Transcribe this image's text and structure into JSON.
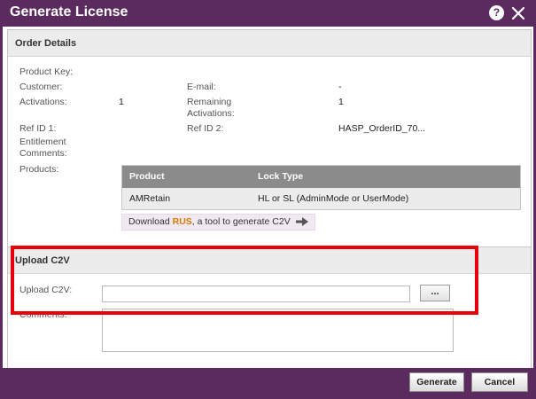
{
  "dialog": {
    "title": "Generate License",
    "help_symbol": "?"
  },
  "order_details": {
    "header": "Order Details",
    "product_key_label": "Product Key:",
    "customer_label": "Customer:",
    "email_label": "E-mail:",
    "email_value": "-",
    "activations_label": "Activations:",
    "activations_value": "1",
    "remaining_label_line1": "Remaining",
    "remaining_label_line2": "Activations:",
    "remaining_value": "1",
    "ref_id1_label": "Ref ID 1:",
    "ref_id2_label": "Ref ID 2:",
    "ref_id2_value": "HASP_OrderID_70...",
    "entitlement_label_line1": "Entitlement",
    "entitlement_label_line2": "Comments:",
    "products_label": "Products:",
    "products_table": {
      "headers": [
        "Product",
        "Lock Type"
      ],
      "rows": [
        [
          "AMRetain",
          "HL or SL (AdminMode or UserMode)"
        ]
      ]
    },
    "rus_link": {
      "prefix": "Download ",
      "highlight": "RUS",
      "suffix": ", a tool to generate C2V",
      "icon": "arrow-right-icon"
    }
  },
  "upload_c2v": {
    "header": "Upload C2V",
    "upload_label": "Upload C2V:",
    "upload_value": "",
    "browse_label": "...",
    "comments_label": "Comments:",
    "comments_value": ""
  },
  "footer": {
    "generate_label": "Generate",
    "cancel_label": "Cancel"
  },
  "colors": {
    "brand": "#5b2a5e",
    "highlight": "#e8000b",
    "rus_accent": "#d57a00"
  }
}
